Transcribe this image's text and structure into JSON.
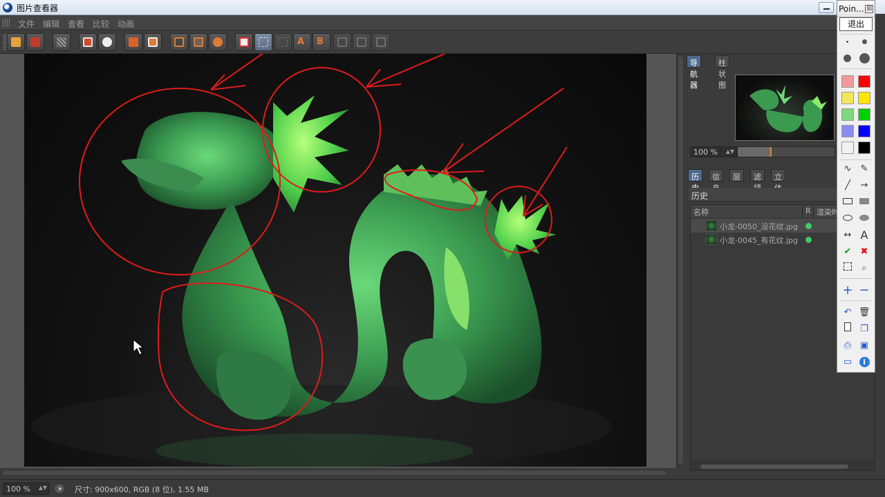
{
  "window": {
    "title": "图片查看器"
  },
  "menu": [
    "文件",
    "编辑",
    "查看",
    "比较",
    "动画"
  ],
  "viewer": {
    "zoom": "100 %",
    "status": "尺寸: 900x600, RGB (8 位), 1.55 MB"
  },
  "toolbar_icons": [
    "open-icon",
    "save-icon",
    "render-region-icon",
    "crop-icon",
    "person-icon",
    "copy-icon",
    "paste-icon",
    "view-single-icon",
    "view-split-icon",
    "view-compare-icon",
    "ab-icon",
    "ab-active-icon",
    "ab-alt-icon",
    "a-to-icon",
    "b-to-icon",
    "layout-1-icon",
    "layout-2-icon",
    "layout-3-icon"
  ],
  "navigator": {
    "tabs": [
      "导航器",
      "柱状图"
    ],
    "zoom": "100 %",
    "zoom_fraction": 0.33
  },
  "panel_tabs": [
    "历史",
    "信息",
    "层",
    "滤镜",
    "立体"
  ],
  "history": {
    "title": "历史",
    "columns": [
      "名称",
      "R",
      "渲染时"
    ],
    "rows": [
      {
        "name": "小龙-0050_没花纹.jpg",
        "status_color": "#41c86a",
        "selected": true
      },
      {
        "name": "小龙-0045_有花纹.jpg",
        "status_color": "#41c86a",
        "selected": false
      }
    ]
  },
  "pointer_palette": {
    "title": "Poin...",
    "close": "☒",
    "exit_label": "退出",
    "colors": [
      "#f29a9a",
      "#ff0000",
      "#f5e65c",
      "#ffe600",
      "#7fd77f",
      "#00d000",
      "#8a8cf0",
      "#0000ff",
      "#f2f2f2",
      "#000000"
    ],
    "tools": [
      "freehand-icon",
      "eraser-icon",
      "line-icon",
      "arrow-icon",
      "rectangle-icon",
      "filled-rectangle-icon",
      "ellipse-icon",
      "filled-ellipse-icon",
      "double-arrow-icon",
      "text-icon",
      "check-icon",
      "cross-icon",
      "select-region-icon",
      "magnifier-icon",
      "plus-icon",
      "minus-icon",
      "undo-icon",
      "trash-icon",
      "new-page-icon",
      "copy-icon",
      "print-icon",
      "save-icon",
      "screen-icon",
      "info-icon"
    ],
    "text_tool_label": "A"
  }
}
